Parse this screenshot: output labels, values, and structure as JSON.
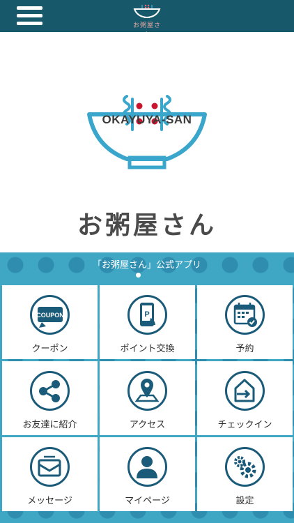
{
  "header": {
    "menu_icon": "hamburger-icon",
    "logo_text": "お粥屋さん",
    "background": "#17596a"
  },
  "hero": {
    "brand_en": "OKAYUYA-SAN",
    "brand_jp": "お粥屋さん",
    "bowl_color": "#3aa6cc",
    "accent_color": "#c8142d"
  },
  "banner": {
    "title": "「お粥屋さん」公式アプリ",
    "pages": 1,
    "active_page": 1
  },
  "menu": {
    "items": [
      {
        "label": "クーポン",
        "icon": "coupon-icon"
      },
      {
        "label": "ポイント交換",
        "icon": "point-card-icon"
      },
      {
        "label": "予約",
        "icon": "calendar-check-icon"
      },
      {
        "label": "お友達に紹介",
        "icon": "share-icon"
      },
      {
        "label": "アクセス",
        "icon": "map-pin-icon"
      },
      {
        "label": "チェックイン",
        "icon": "checkin-icon"
      },
      {
        "label": "メッセージ",
        "icon": "mail-icon"
      },
      {
        "label": "マイページ",
        "icon": "user-icon"
      },
      {
        "label": "設定",
        "icon": "gear-icon"
      }
    ],
    "coupon_badge": "COUPON"
  },
  "colors": {
    "tile_icon": "#1b5b7a",
    "banner_bg": "#3fa6c4",
    "banner_dots": "#2f8eb0"
  }
}
